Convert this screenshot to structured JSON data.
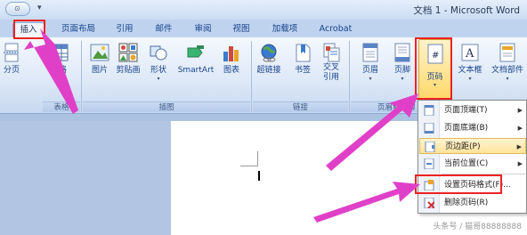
{
  "window": {
    "title": "文档 1 - Microsoft Word",
    "office_button_glyph": "⊙"
  },
  "tabs": [
    {
      "label": "插入",
      "active": true
    },
    {
      "label": "页面布局",
      "active": false
    },
    {
      "label": "引用",
      "active": false
    },
    {
      "label": "邮件",
      "active": false
    },
    {
      "label": "审阅",
      "active": false
    },
    {
      "label": "视图",
      "active": false
    },
    {
      "label": "加载项",
      "active": false
    },
    {
      "label": "Acrobat",
      "active": false
    }
  ],
  "ribbon": {
    "buttons": {
      "page_break": "分页",
      "table": "表格",
      "picture": "图片",
      "clipart": "剪贴画",
      "shapes": "形状",
      "smartart": "SmartArt",
      "chart": "图表",
      "hyperlink": "超链接",
      "bookmark": "书签",
      "crossref_line1": "交叉",
      "crossref_line2": "引用",
      "header": "页眉",
      "footer": "页脚",
      "page_number": "页码",
      "textbox": "文本框",
      "quickparts": "文档部件"
    },
    "groups": {
      "tables": "表格",
      "illustrations": "插图",
      "links": "链接",
      "header_footer": "页眉和页脚"
    },
    "colors": {
      "accent_highlight": "#ffd86b",
      "annotation_red": "#ee2222",
      "annotation_pink": "#e040c8"
    }
  },
  "menu": {
    "items": [
      {
        "label": "页面顶端(T)",
        "has_submenu": true,
        "icon": "page-top-icon"
      },
      {
        "label": "页面底端(B)",
        "has_submenu": true,
        "icon": "page-bottom-icon"
      },
      {
        "label": "页边距(P)",
        "has_submenu": true,
        "icon": "page-margin-icon",
        "highlighted": true
      },
      {
        "label": "当前位置(C)",
        "has_submenu": true,
        "icon": "current-position-icon"
      },
      {
        "label": "设置页码格式(F)...",
        "has_submenu": false,
        "icon": "format-page-number-icon"
      },
      {
        "label": "删除页码(R)",
        "has_submenu": false,
        "icon": "remove-page-number-icon"
      }
    ]
  },
  "watermark": "头条号 / 猫哥88888888"
}
